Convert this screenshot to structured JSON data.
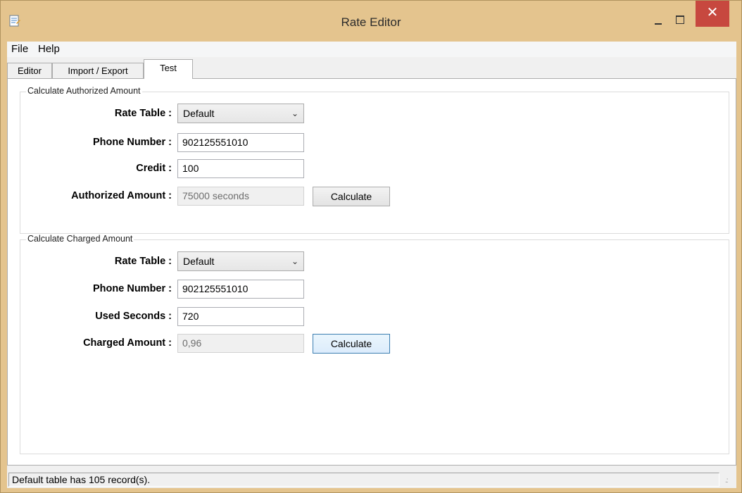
{
  "window": {
    "title": "Rate Editor",
    "close_glyph": "✕",
    "colors": {
      "frame": "#e4c48e",
      "close": "#c7483f",
      "client": "#f0f0f0"
    }
  },
  "menu": [
    "File",
    "Help"
  ],
  "tabs": [
    "Editor",
    "Import / Export",
    "Test"
  ],
  "active_tab": "Test",
  "authorized": {
    "group_title": "Calculate Authorized Amount",
    "rate_table_label": "Rate Table :",
    "rate_table_value": "Default",
    "phone_label": "Phone Number :",
    "phone_value": "902125551010",
    "credit_label": "Credit :",
    "credit_value": "100",
    "result_label": "Authorized Amount :",
    "result_value": "75000 seconds",
    "calculate_label": "Calculate"
  },
  "charged": {
    "group_title": "Calculate Charged Amount",
    "rate_table_label": "Rate Table :",
    "rate_table_value": "Default",
    "phone_label": "Phone Number :",
    "phone_value": "902125551010",
    "seconds_label": "Used Seconds :",
    "seconds_value": "720",
    "result_label": "Charged Amount :",
    "result_value": "0,96",
    "calculate_label": "Calculate"
  },
  "status": {
    "text": "Default table has 105 record(s)."
  },
  "icons": [
    "app-icon",
    "minimize-icon",
    "maximize-icon",
    "close-icon",
    "chevron-down-icon",
    "resize-grip-icon"
  ]
}
